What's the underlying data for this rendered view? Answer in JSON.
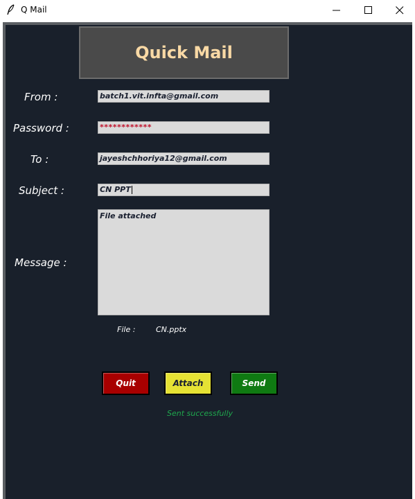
{
  "window": {
    "title": "Q Mail",
    "icons": {
      "app": "feather-icon",
      "minimize": "minimize-icon",
      "maximize": "maximize-icon",
      "close": "close-icon"
    }
  },
  "header": {
    "title": "Quick Mail"
  },
  "form": {
    "from_label": "From :",
    "from_value": "batch1.vit.infta@gmail.com",
    "password_label": "Password :",
    "password_value": "************",
    "to_label": "To :",
    "to_value": "jayeshchhoriya12@gmail.com",
    "subject_label": "Subject :",
    "subject_value": "CN PPT",
    "message_label": "Message :",
    "message_value": "File attached",
    "file_label": "File :",
    "file_value": "CN.pptx"
  },
  "buttons": {
    "quit": "Quit",
    "attach": "Attach",
    "send": "Send"
  },
  "status": {
    "text": "Sent successfully"
  },
  "colors": {
    "background": "#19202b",
    "header_bg": "#4a4a4a",
    "header_text": "#f9d9a5",
    "quit": "#a80000",
    "attach": "#e6e234",
    "send": "#0f7a12",
    "status": "#1fa84d",
    "password_text": "#c0102a"
  }
}
